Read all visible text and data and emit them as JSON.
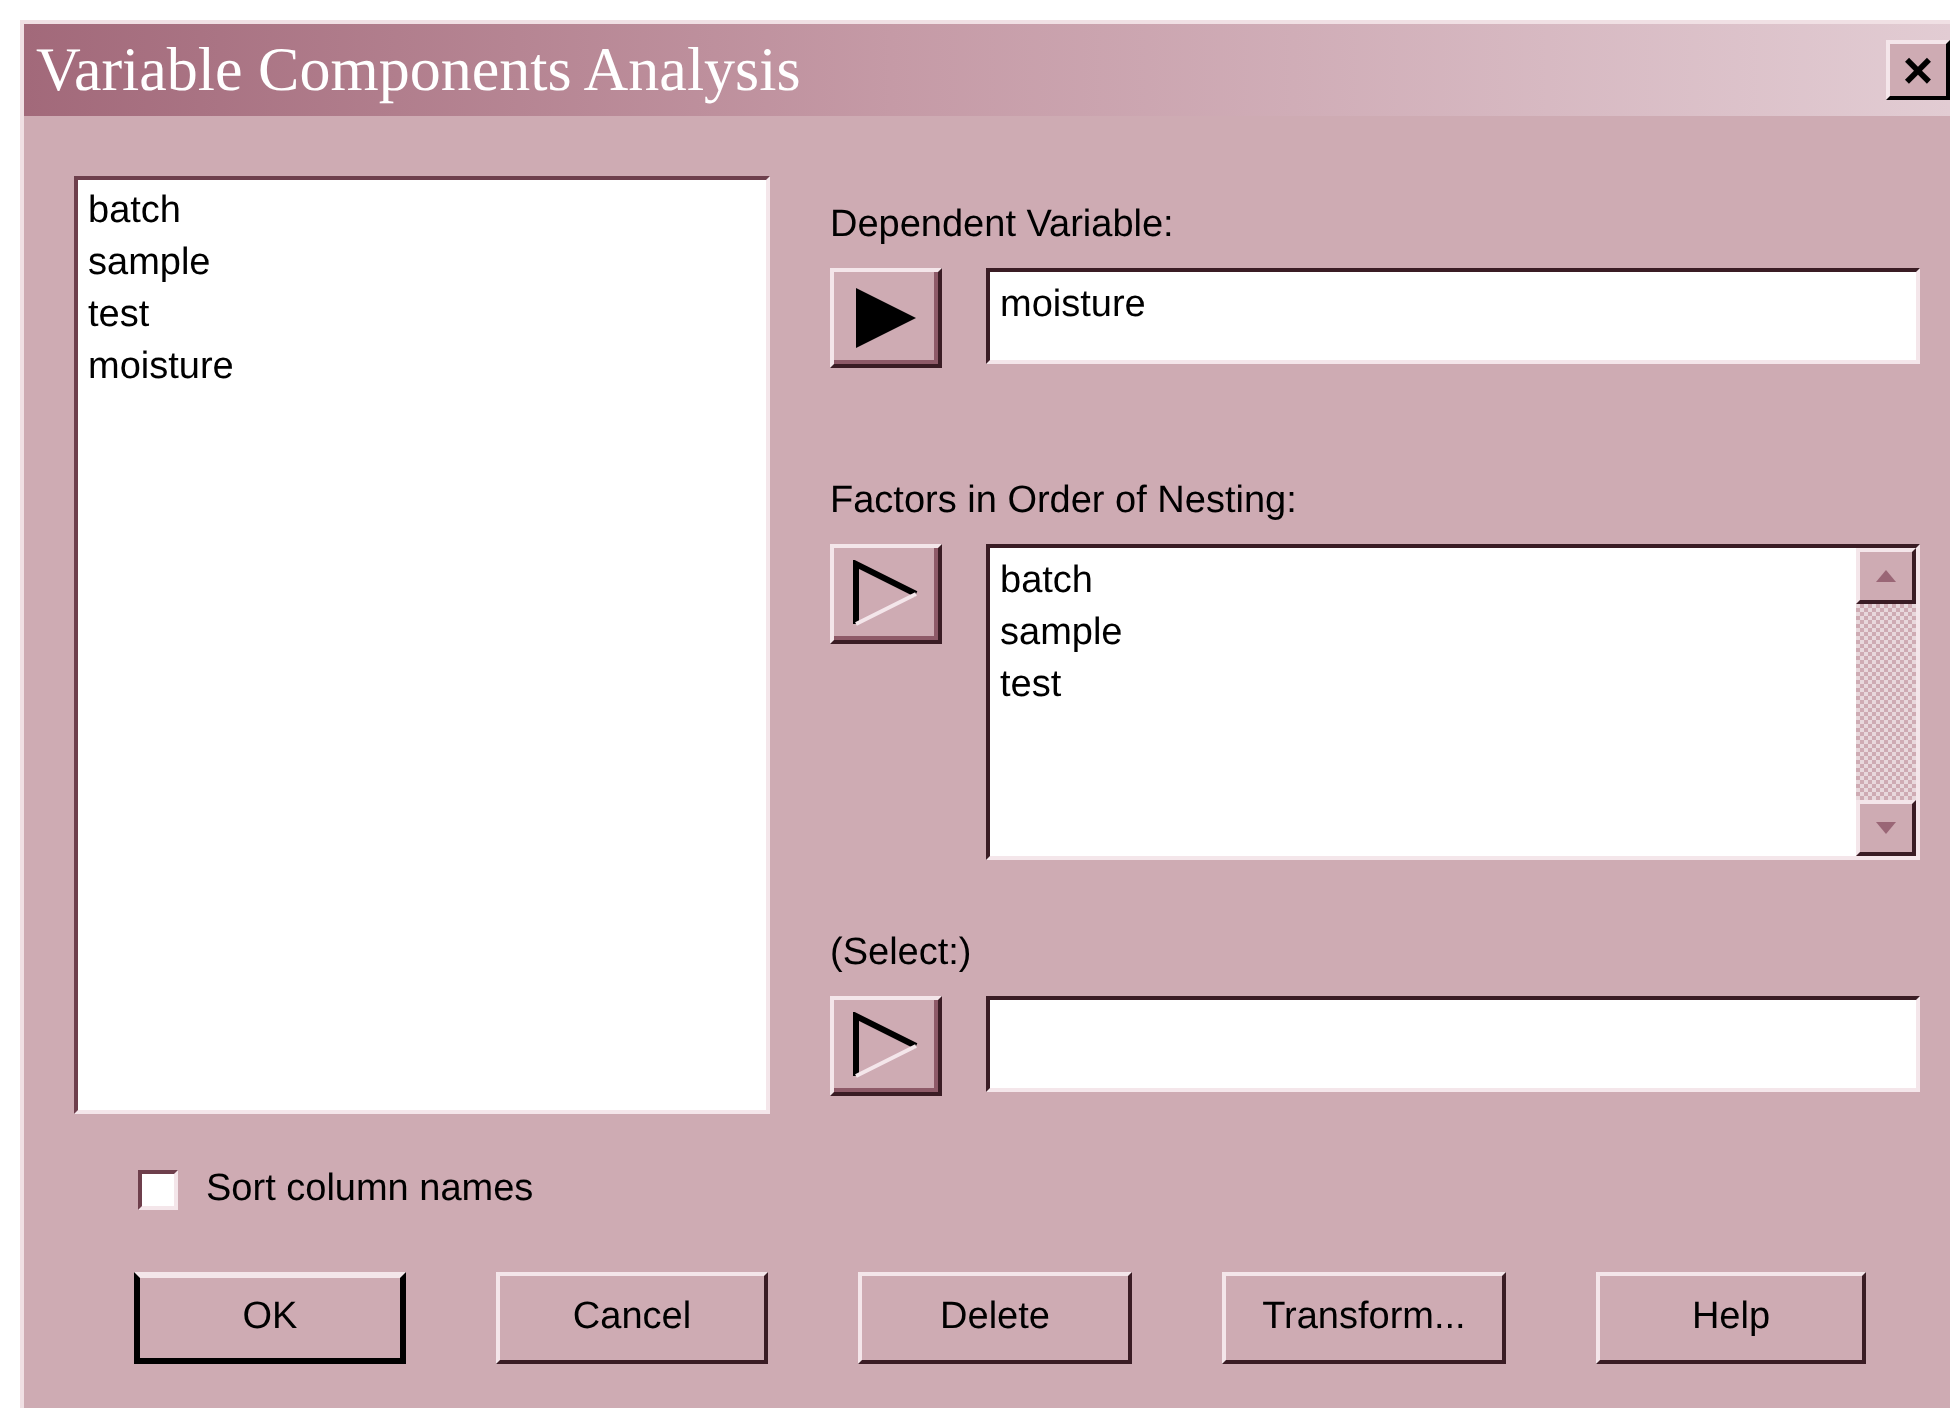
{
  "window": {
    "title": "Variable Components Analysis",
    "close": "×"
  },
  "column_list": {
    "items": [
      "batch",
      "sample",
      "test",
      "moisture"
    ]
  },
  "dependent_variable": {
    "label": "Dependent Variable:",
    "arrow_active": true,
    "value": "moisture"
  },
  "factors": {
    "label": "Factors in Order of Nesting:",
    "arrow_active": false,
    "items": [
      "batch",
      "sample",
      "test"
    ]
  },
  "select": {
    "label": "(Select:)",
    "arrow_active": false
  },
  "sort_column_names": {
    "label": "Sort column names",
    "checked": false
  },
  "buttons": [
    {
      "label": "OK",
      "default": true
    },
    {
      "label": "Cancel",
      "default": false
    },
    {
      "label": "Delete",
      "default": false
    },
    {
      "label": "Transform...",
      "default": false
    },
    {
      "label": "Help",
      "default": false
    }
  ]
}
